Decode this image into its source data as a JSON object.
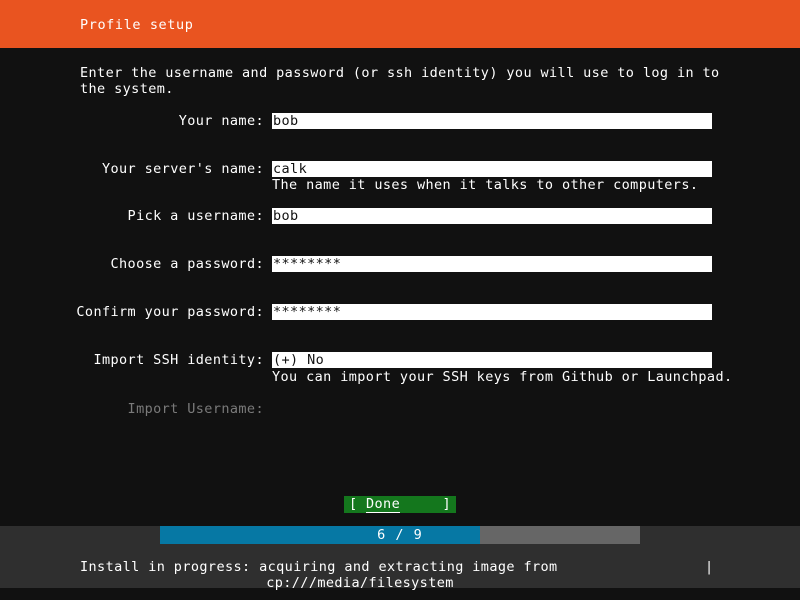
{
  "header": {
    "title": "Profile setup",
    "background": "#e95420"
  },
  "intro": "Enter the username and password (or ssh identity) you will use to log in to the system.",
  "form": {
    "fields": [
      {
        "label": "Your name:",
        "value": "bob",
        "hint": "",
        "disabled": false,
        "type": "text"
      },
      {
        "label": "Your server's name:",
        "value": "calk",
        "hint": "The name it uses when it talks to other computers.",
        "disabled": false,
        "type": "text"
      },
      {
        "label": "Pick a username:",
        "value": "bob",
        "hint": "",
        "disabled": false,
        "type": "text"
      },
      {
        "label": "Choose a password:",
        "value": "********",
        "hint": "",
        "disabled": false,
        "type": "password"
      },
      {
        "label": "Confirm your password:",
        "value": "********",
        "hint": "",
        "disabled": false,
        "type": "password"
      },
      {
        "label": "Import SSH identity:",
        "value": "(+) No",
        "hint": "You can import your SSH keys from Github or Launchpad.",
        "disabled": false,
        "type": "select"
      },
      {
        "label": "Import Username:",
        "value": "",
        "hint": "",
        "disabled": true,
        "type": "text"
      }
    ]
  },
  "done_button": {
    "bracket_left": "[",
    "label": "Done",
    "bracket_right": "]",
    "background": "#14771d"
  },
  "footer": {
    "progress": {
      "label": "6 / 9",
      "current": 6,
      "total": 9,
      "fill_color": "#0678a4",
      "track_color": "#666666"
    },
    "status_line1": "Install in progress: acquiring and extracting image from",
    "status_line2": "cp:///media/filesystem",
    "spinner": "|"
  }
}
